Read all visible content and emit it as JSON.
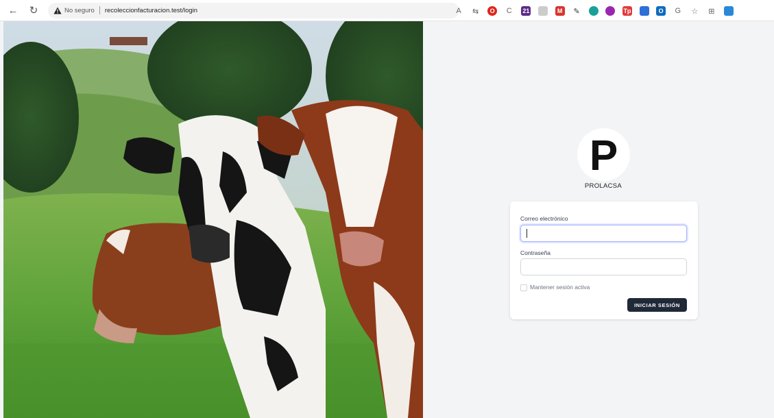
{
  "browser": {
    "security_label": "No seguro",
    "url": "recoleccionfacturacion.test/login"
  },
  "extensions": [
    {
      "name": "read-aloud-icon",
      "glyph": "A",
      "color": "#666666"
    },
    {
      "name": "tab-actions-icon",
      "glyph": "⇆",
      "color": "#666666"
    },
    {
      "name": "opera-icon",
      "glyph": "O",
      "color": "#e0241b"
    },
    {
      "name": "extension-ci-icon",
      "glyph": "C",
      "color": "#666666"
    },
    {
      "name": "extension-badge-icon",
      "glyph": "21",
      "color": "#5b2a86"
    },
    {
      "name": "extension-square-icon",
      "glyph": "",
      "color": "#cccccc"
    },
    {
      "name": "extension-red-icon",
      "glyph": "M",
      "color": "#d9342b"
    },
    {
      "name": "extension-pen-icon",
      "glyph": "✎",
      "color": "#333333"
    },
    {
      "name": "extension-teal-icon",
      "glyph": "",
      "color": "#1aa197"
    },
    {
      "name": "extension-purple-icon",
      "glyph": "",
      "color": "#9b27b0"
    },
    {
      "name": "extension-tp-icon",
      "glyph": "Tp",
      "color": "#e23b3b"
    },
    {
      "name": "extension-blue-icon",
      "glyph": "",
      "color": "#2f6fd8"
    },
    {
      "name": "outlook-icon",
      "glyph": "O",
      "color": "#0f6cbd"
    },
    {
      "name": "extension-ring-icon",
      "glyph": "G",
      "color": "#666666"
    },
    {
      "name": "favorites-icon",
      "glyph": "☆",
      "color": "#666666"
    },
    {
      "name": "collections-icon",
      "glyph": "⊞",
      "color": "#666666"
    },
    {
      "name": "extension-square2-icon",
      "glyph": "",
      "color": "#2b88d8"
    }
  ],
  "brand": {
    "letter": "P",
    "name": "PROLACSA"
  },
  "form": {
    "email_label": "Correo electrónico",
    "email_value": "",
    "password_label": "Contraseña",
    "password_value": "",
    "remember_label": "Mantener sesión activa",
    "submit_label": "INICIAR SESIÓN"
  },
  "colors": {
    "page_bg": "#f3f4f6",
    "button_bg": "#1f2937",
    "focus_ring": "#a5b4fc"
  }
}
